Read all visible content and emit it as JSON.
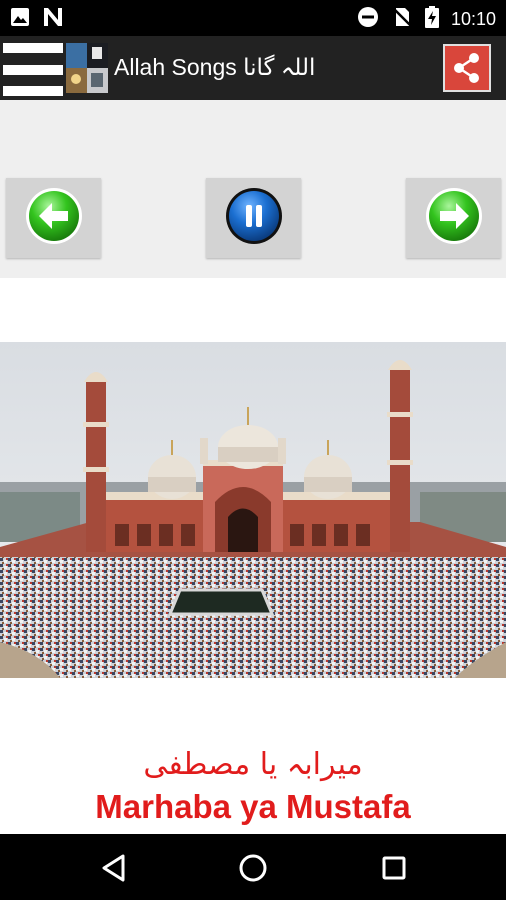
{
  "status_bar": {
    "time": "10:10",
    "icons": [
      "image-icon",
      "n-icon",
      "do-not-disturb-icon",
      "no-sim-icon",
      "battery-charging-icon"
    ]
  },
  "app_bar": {
    "title": "Allah Songs اللہ گانا",
    "icons": [
      "menu-icon",
      "share-icon"
    ]
  },
  "controls": {
    "icons": [
      "back-arrow-icon",
      "pause-icon",
      "forward-arrow-icon"
    ]
  },
  "song": {
    "title_urdu": "میرابہ یا مصطفی",
    "title_en": "Marhaba ya Mustafa"
  },
  "nav_bar": {
    "icons": [
      "back-icon",
      "home-icon",
      "recents-icon"
    ]
  },
  "colors": {
    "accent_red": "#e11c1c",
    "share_bg": "#d9463b",
    "green_button": "#33c41e",
    "blue_button": "#1b6fd1"
  }
}
